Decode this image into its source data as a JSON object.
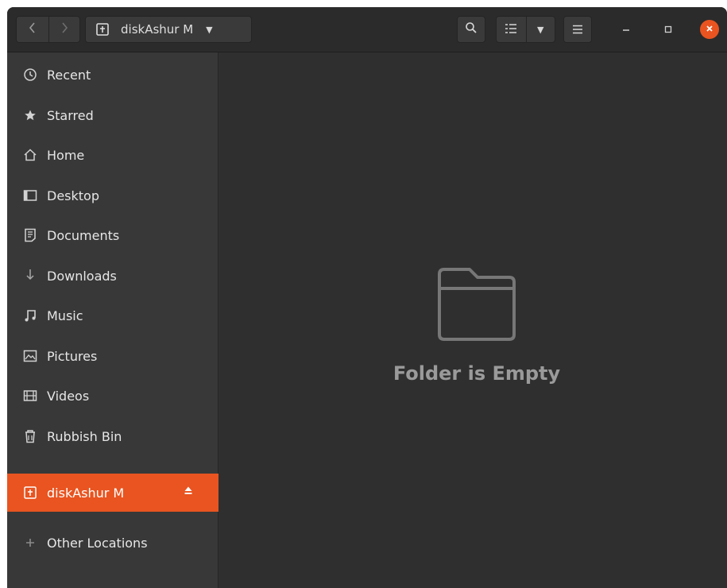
{
  "header": {
    "path_label": "diskAshur M",
    "back_icon": "chevron-left-icon",
    "forward_icon": "chevron-right-icon",
    "search_icon": "search-icon",
    "view_icon": "list-view-icon",
    "menu_icon": "hamburger-menu-icon",
    "close_color": "#e95420"
  },
  "sidebar": {
    "items": [
      {
        "label": "Recent",
        "icon": "clock-icon"
      },
      {
        "label": "Starred",
        "icon": "star-icon"
      },
      {
        "label": "Home",
        "icon": "home-icon"
      },
      {
        "label": "Desktop",
        "icon": "desktop-icon"
      },
      {
        "label": "Documents",
        "icon": "document-icon"
      },
      {
        "label": "Downloads",
        "icon": "download-icon"
      },
      {
        "label": "Music",
        "icon": "music-icon"
      },
      {
        "label": "Pictures",
        "icon": "picture-icon"
      },
      {
        "label": "Videos",
        "icon": "video-icon"
      },
      {
        "label": "Rubbish Bin",
        "icon": "trash-icon"
      }
    ],
    "drive": {
      "label": "diskAshur M",
      "icon": "drive-icon",
      "selected": true
    },
    "other": {
      "label": "Other Locations",
      "icon": "plus-icon"
    }
  },
  "content": {
    "empty_message": "Folder is Empty",
    "empty_icon": "folder-icon"
  },
  "colors": {
    "accent": "#e95420",
    "window_bg": "#2f2f2f",
    "sidebar_bg": "#383838"
  }
}
